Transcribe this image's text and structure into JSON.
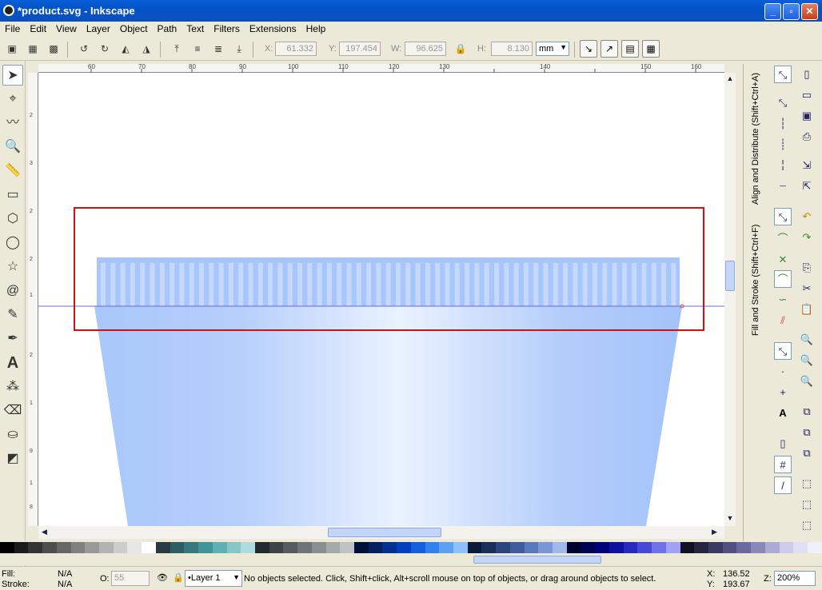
{
  "window": {
    "title": "*product.svg - Inkscape",
    "min": "_",
    "max": "▫",
    "close": "✕"
  },
  "menu": [
    "File",
    "Edit",
    "View",
    "Layer",
    "Object",
    "Path",
    "Text",
    "Filters",
    "Extensions",
    "Help"
  ],
  "controls": {
    "x_label": "X:",
    "x_value": "61.332",
    "y_label": "Y:",
    "y_value": "197.454",
    "w_label": "W:",
    "w_value": "96.625",
    "h_label": "H:",
    "h_value": "8.130",
    "unit": "mm"
  },
  "ruler": {
    "h_ticks": [
      "60",
      "70",
      "80",
      "90",
      "100",
      "110",
      "120",
      "130",
      "140",
      "150",
      "160"
    ],
    "v_ticks": [
      "2",
      "3",
      "2",
      "2",
      "1",
      "2",
      "1",
      "9",
      "1",
      "8"
    ]
  },
  "dock": {
    "tab1": "Align and Distribute (Shift+Ctrl+A)",
    "tab2": "Fill and Stroke (Shift+Ctrl+F)"
  },
  "palette": [
    "#000000",
    "#1a1a1a",
    "#333333",
    "#4d4d4d",
    "#666666",
    "#808080",
    "#999999",
    "#b3b3b3",
    "#cccccc",
    "#e6e6e6",
    "#ffffff",
    "#2b3a42",
    "#2e5e63",
    "#35797e",
    "#3d9598",
    "#5fb0b3",
    "#86c6c7",
    "#aedcdc",
    "#24292e",
    "#3b4347",
    "#555c60",
    "#6e7578",
    "#898f91",
    "#a4a9aa",
    "#c0c3c3",
    "#00103a",
    "#002060",
    "#003090",
    "#0040c0",
    "#1060e0",
    "#3080f0",
    "#5ca0f5",
    "#8ec0fa",
    "#0c1a3a",
    "#1a2e5a",
    "#2c4480",
    "#405aa0",
    "#5a78c0",
    "#7a96d8",
    "#a0b8ea",
    "#000030",
    "#000055",
    "#00007a",
    "#1010a0",
    "#2828c0",
    "#4848d8",
    "#7070e8",
    "#a0a0f4",
    "#101020",
    "#252540",
    "#3a3a60",
    "#505080",
    "#6a6aa0",
    "#8888bb",
    "#aaaad4",
    "#ccccea",
    "#e0e0f4",
    "#f0f0fa"
  ],
  "status": {
    "fill_label": "Fill:",
    "fill_value": "N/A",
    "stroke_label": "Stroke:",
    "stroke_value": "N/A",
    "opacity_label": "O:",
    "opacity_value": "55",
    "layer": "•Layer 1",
    "message": "No objects selected. Click, Shift+click, Alt+scroll mouse on top of objects, or drag around objects to select.",
    "x_label": "X:",
    "x_value": "136.52",
    "y_label": "Y:",
    "y_value": "193.67",
    "zoom_label": "Z:",
    "zoom_value": "200%"
  }
}
